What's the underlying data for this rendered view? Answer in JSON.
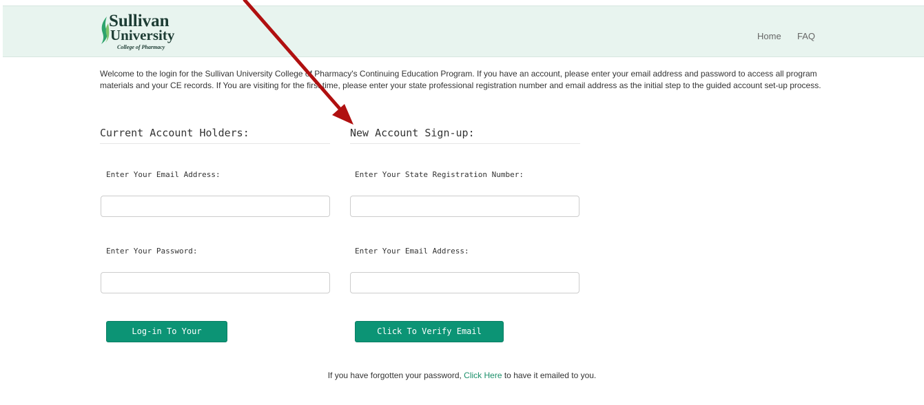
{
  "header": {
    "logo": {
      "line1": "Sullivan",
      "line2": "University",
      "line3": "College of Pharmacy"
    },
    "nav": {
      "home": "Home",
      "faq": "FAQ"
    }
  },
  "intro_text": "Welcome to the login for the Sullivan University College of Pharmacy's Continuing Education Program. If you have an account, please enter your email address and password to access all program materials and your CE records. If You are visiting for the first time, please enter your state professional registration number and email address as the initial step to the guided account set-up process.",
  "current_account": {
    "title": "Current Account Holders:",
    "email_label": "Enter Your Email Address:",
    "email_value": "",
    "password_label": "Enter Your Password:",
    "password_value": "",
    "button_label": "Log-in To Your Account"
  },
  "new_account": {
    "title": "New Account Sign-up:",
    "registration_label": "Enter Your State Registration Number:",
    "registration_value": "",
    "email_label": "Enter Your Email Address:",
    "email_value": "",
    "button_label": "Click To Verify Email Address"
  },
  "forgot": {
    "prefix": "If you have forgotten your password, ",
    "link": "Click Here",
    "suffix": " to have it emailed to you."
  },
  "colors": {
    "header_bg": "#e8f4ef",
    "button_bg": "#0c9475",
    "link": "#1b8f6a",
    "annotation_arrow": "#b01010"
  }
}
